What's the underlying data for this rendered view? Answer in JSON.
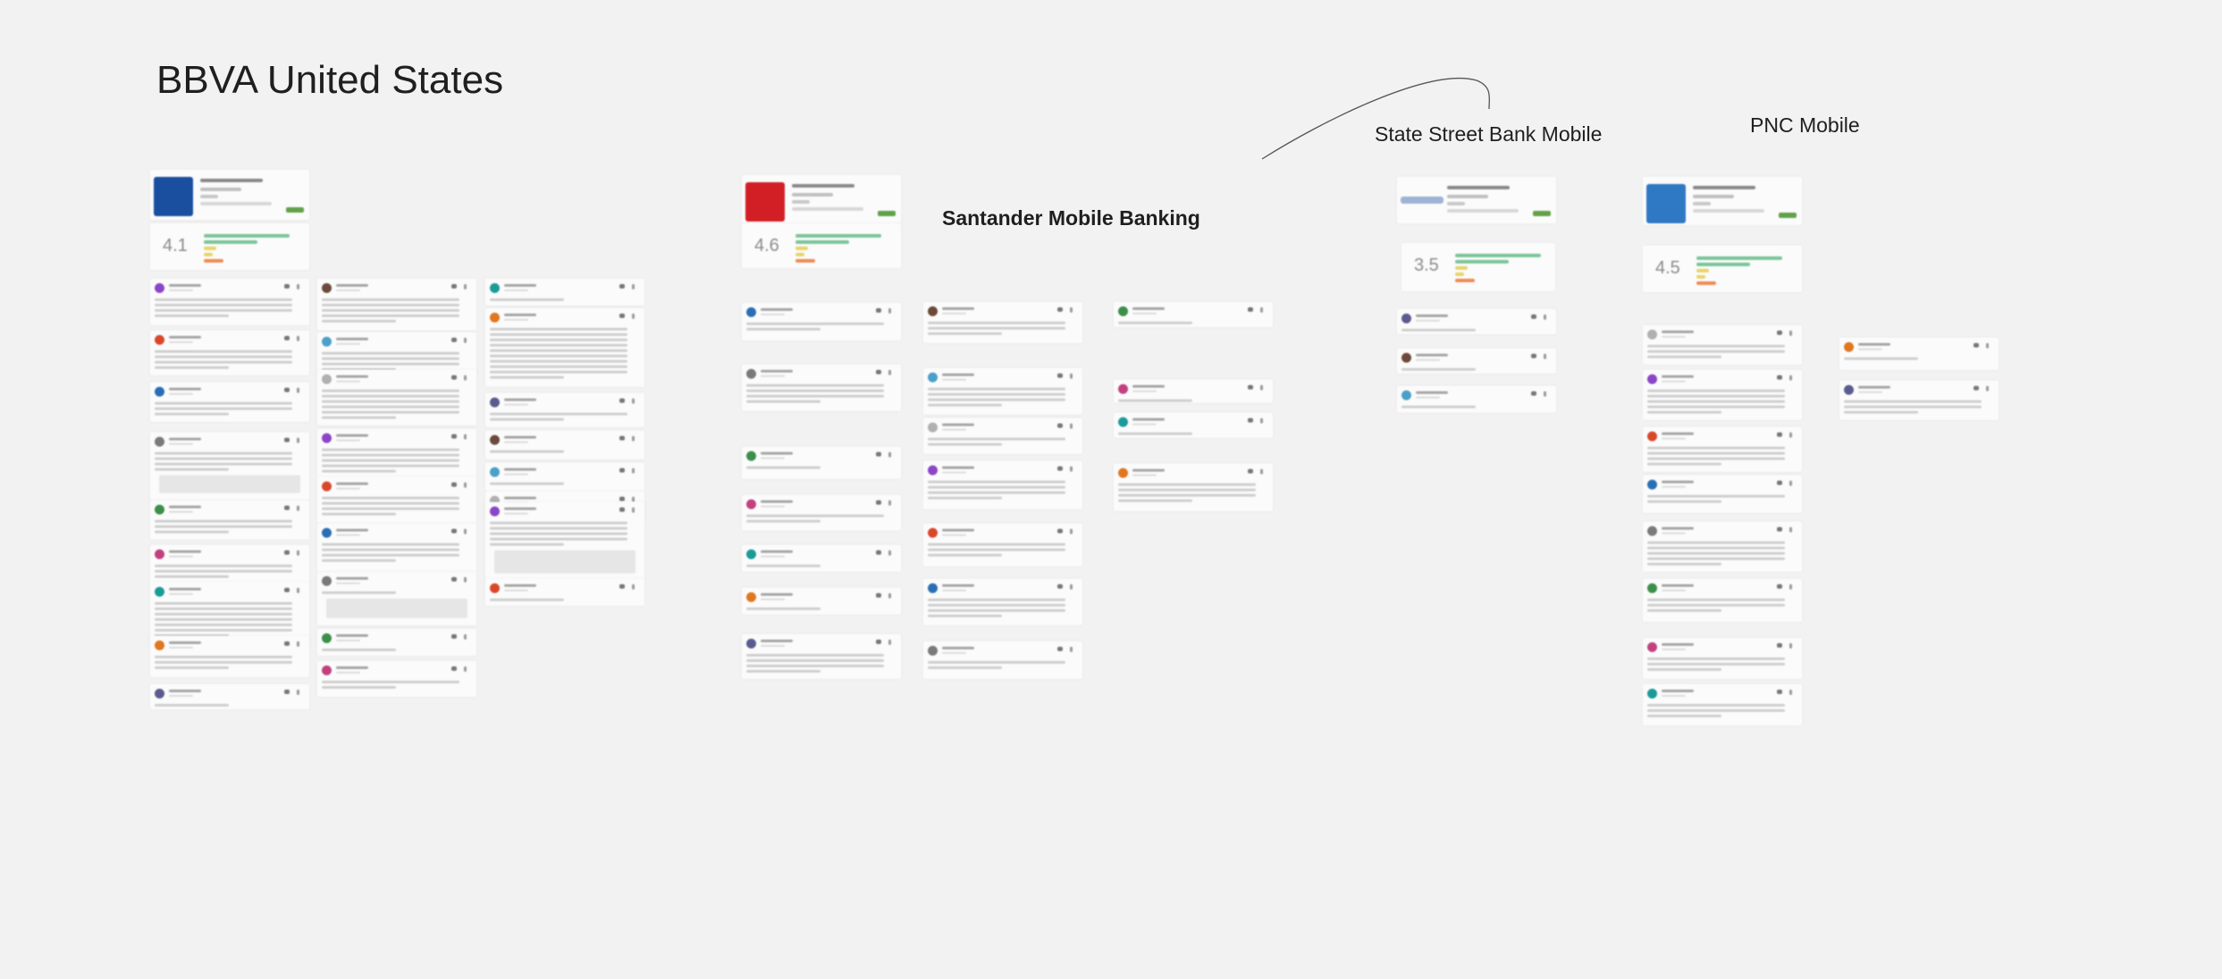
{
  "sections": {
    "bbva": "BBVA United States",
    "state_street": "State Street Bank Mobile",
    "pnc": "PNC Mobile",
    "santander": "Santander Mobile Banking"
  },
  "colors": {
    "background": "#f2f2f2",
    "bbva_brand": "#1a4fa0",
    "santander_brand": "#d21f26",
    "pnc_brand": "#2f78c4",
    "bar_positive": "#7cc59a",
    "bar_neutral": "#e9d46a",
    "bar_negative": "#ef8c57",
    "install_button": "#62a14a"
  },
  "apps": [
    {
      "id": "bbva",
      "icon": "bbva-logo-icon",
      "rating": "4.1"
    },
    {
      "id": "santander",
      "icon": "santander-flame-logo-icon",
      "rating": "4.6"
    },
    {
      "id": "state-street",
      "icon": "state-street-logo-icon",
      "rating": "3.5"
    },
    {
      "id": "pnc",
      "icon": "pnc-logo-icon",
      "rating": "4.5"
    }
  ]
}
